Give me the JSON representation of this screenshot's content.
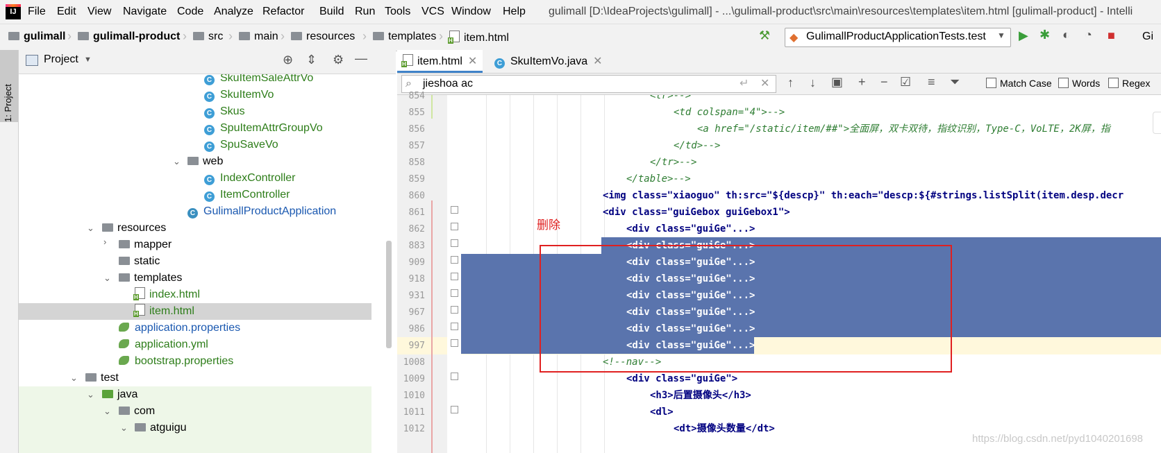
{
  "menubar": {
    "items": [
      "File",
      "Edit",
      "View",
      "Navigate",
      "Code",
      "Analyze",
      "Refactor",
      "Build",
      "Run",
      "Tools",
      "VCS",
      "Window",
      "Help"
    ],
    "title": "gulimall [D:\\IdeaProjects\\gulimall] - ...\\gulimall-product\\src\\main\\resources\\templates\\item.html [gulimall-product] - Intelli"
  },
  "navbar": {
    "crumbs": [
      "gulimall",
      "gulimall-product",
      "src",
      "main",
      "resources",
      "templates",
      "item.html"
    ],
    "run_config": "GulimallProductApplicationTests.test",
    "right_text": "Gi"
  },
  "left_strip": {
    "tab_label": "1: Project"
  },
  "project": {
    "title": "Project",
    "items": [
      {
        "label": "SkuItemSaleAttrVo",
        "kind": "class"
      },
      {
        "label": "SkuItemVo",
        "kind": "class"
      },
      {
        "label": "Skus",
        "kind": "class"
      },
      {
        "label": "SpuItemAttrGroupVo",
        "kind": "class"
      },
      {
        "label": "SpuSaveVo",
        "kind": "class"
      },
      {
        "label": "web",
        "kind": "folder"
      },
      {
        "label": "IndexController",
        "kind": "class"
      },
      {
        "label": "ItemController",
        "kind": "class"
      },
      {
        "label": "GulimallProductApplication",
        "kind": "app"
      },
      {
        "label": "resources",
        "kind": "folder"
      },
      {
        "label": "mapper",
        "kind": "folder"
      },
      {
        "label": "static",
        "kind": "folder"
      },
      {
        "label": "templates",
        "kind": "folder"
      },
      {
        "label": "index.html",
        "kind": "html"
      },
      {
        "label": "item.html",
        "kind": "html"
      },
      {
        "label": "application.properties",
        "kind": "spring"
      },
      {
        "label": "application.yml",
        "kind": "spring"
      },
      {
        "label": "bootstrap.properties",
        "kind": "spring"
      },
      {
        "label": "test",
        "kind": "folder"
      },
      {
        "label": "java",
        "kind": "folder"
      },
      {
        "label": "com",
        "kind": "folder"
      },
      {
        "label": "atguigu",
        "kind": "folder"
      }
    ]
  },
  "editor": {
    "tabs": [
      "item.html",
      "SkuItemVo.java"
    ],
    "search_value": "jieshoa ac",
    "options": [
      "Match Case",
      "Words",
      "Regex"
    ],
    "line_numbers": [
      "854",
      "855",
      "856",
      "857",
      "858",
      "859",
      "860",
      "861",
      "862",
      "883",
      "909",
      "918",
      "931",
      "967",
      "986",
      "997",
      "1008",
      "1009",
      "1010",
      "1011",
      "1012"
    ],
    "lines": [
      "<tr>-->",
      "<td colspan=\"4\">-->",
      "<a href=\"/static/item/##\">全面屏，双卡双待，指纹识别，Type-C，VoLTE，2K屏，指",
      "</td>-->",
      "</tr>-->",
      "</table>-->",
      "<img class=\"xiaoguo\" th:src=\"${descp}\" th:each=\"descp:${#strings.listSplit(item.desp.decr",
      "<div class=\"guiGebox guiGebox1\">",
      "<div class=\"guiGe\"...>",
      "<div class=\"guiGe\"...>",
      "<div class=\"guiGe\"...>",
      "<div class=\"guiGe\"...>",
      "<div class=\"guiGe\"...>",
      "<div class=\"guiGe\"...>",
      "<div class=\"guiGe\"...>",
      "<div class=\"guiGe\"...>",
      "<!--nav-->",
      "<div class=\"guiGe\">",
      "<h3>后置摄像头</h3>",
      "<dl>",
      "<dt>摄像头数量</dt>"
    ]
  },
  "annotation": {
    "delete_label": "删除"
  },
  "watermark": "https://blog.csdn.net/pyd1040201698"
}
